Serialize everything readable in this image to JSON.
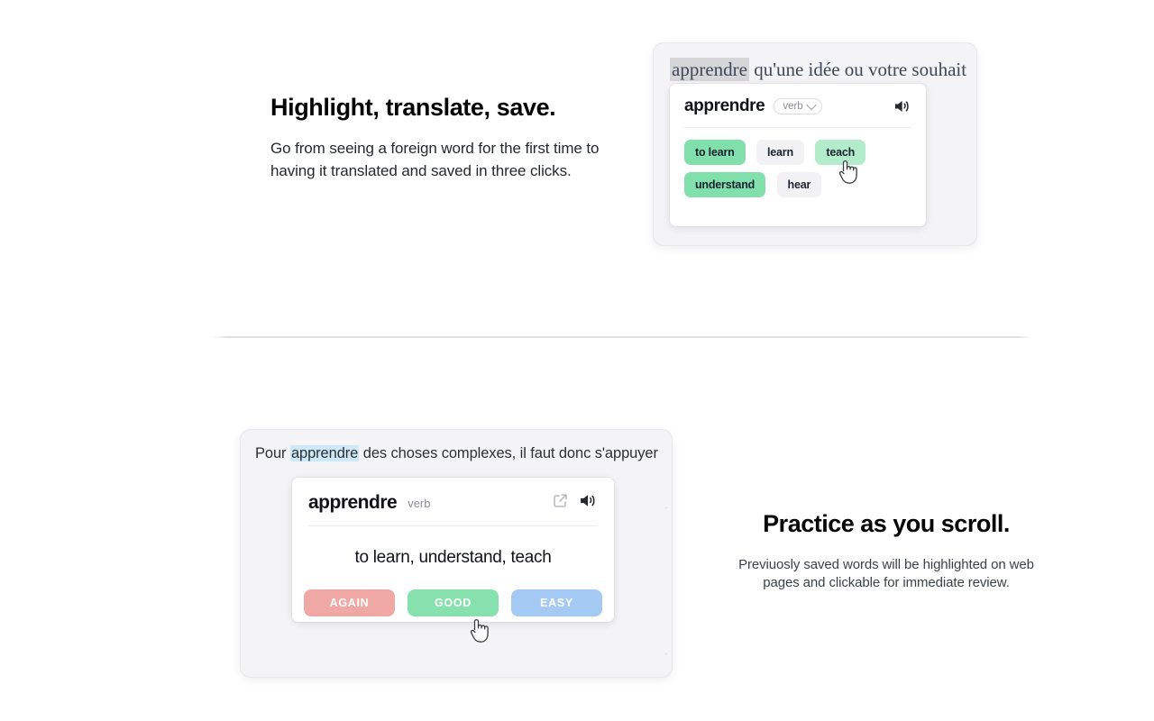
{
  "section1": {
    "headline": "Highlight, translate, save.",
    "body": "Go from seeing a foreign word for the first time to having it translated and saved in three clicks.",
    "screenshot": {
      "page_text_highlighted": "apprendre",
      "page_text_rest": " qu'une idée ou votre souhait",
      "popup": {
        "word": "apprendre",
        "part_of_speech": "verb",
        "speaker_icon": "speaker-icon",
        "chevron_icon": "chevron-down-icon",
        "translations": [
          {
            "label": "to learn",
            "state": "saved"
          },
          {
            "label": "learn",
            "state": "plain"
          },
          {
            "label": "teach",
            "state": "hover"
          },
          {
            "label": "understand",
            "state": "saved"
          },
          {
            "label": "hear",
            "state": "plain"
          }
        ]
      }
    }
  },
  "section2": {
    "headline": "Practice as you scroll.",
    "body": "Previuosly saved words will be highlighted on web pages and clickable for immediate review.",
    "screenshot": {
      "page_text_before": "Pour ",
      "page_text_highlighted": "apprendre",
      "page_text_after": " des choses complexes, il faut donc s'appuyer",
      "edge_fragment_top": ".",
      "edge_fragment_bottom": ".",
      "popup": {
        "word": "apprendre",
        "part_of_speech": "verb",
        "external_link_icon": "external-link-icon",
        "speaker_icon": "speaker-icon",
        "meaning": "to learn, understand, teach",
        "rating_buttons": [
          {
            "label": "AGAIN",
            "color": "#efa8a4"
          },
          {
            "label": "GOOD",
            "color": "#86e1ae"
          },
          {
            "label": "EASY",
            "color": "#a4c9f2"
          }
        ]
      }
    }
  },
  "colors": {
    "saved_chip": "#81dfac",
    "hover_chip": "#b3ecca",
    "plain_chip": "#f2f2f4",
    "highlight_grey": "#d6d6d9",
    "highlight_blue": "#cfe8f7",
    "panel_bg": "#f4f4f6"
  }
}
